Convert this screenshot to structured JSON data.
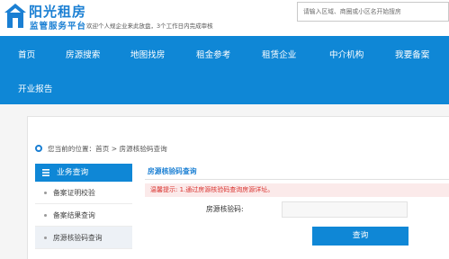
{
  "brand": {
    "title": "阳光租房",
    "subtitle": "监管服务平台",
    "note": "欢迎个人规企业来此放盘，3个工作日内完成审核"
  },
  "search": {
    "placeholder": "请输入区域、商圈或小区名开始搜房"
  },
  "nav": {
    "items": [
      "首页",
      "房源搜索",
      "地图找房",
      "租金参考",
      "租赁企业",
      "中介机构",
      "我要备案",
      "开业报告"
    ]
  },
  "breadcrumb": {
    "text": "您当前的位置：首页 > 房源核验码查询"
  },
  "sidebar": {
    "heading": "业务查询",
    "items": [
      {
        "label": "备案证明校验"
      },
      {
        "label": "备案结果查询"
      },
      {
        "label": "房源核验码查询"
      }
    ]
  },
  "main": {
    "title": "房源核验码查询",
    "warning": "温馨提示: 1.通过房源核验码查询房源详址。",
    "form_label": "房源核验码:",
    "input_value": "",
    "submit_label": "查询"
  },
  "colors": {
    "brand_blue": "#0f87d6",
    "warning_red": "#d9322e",
    "warning_bg": "#fbeaea"
  }
}
